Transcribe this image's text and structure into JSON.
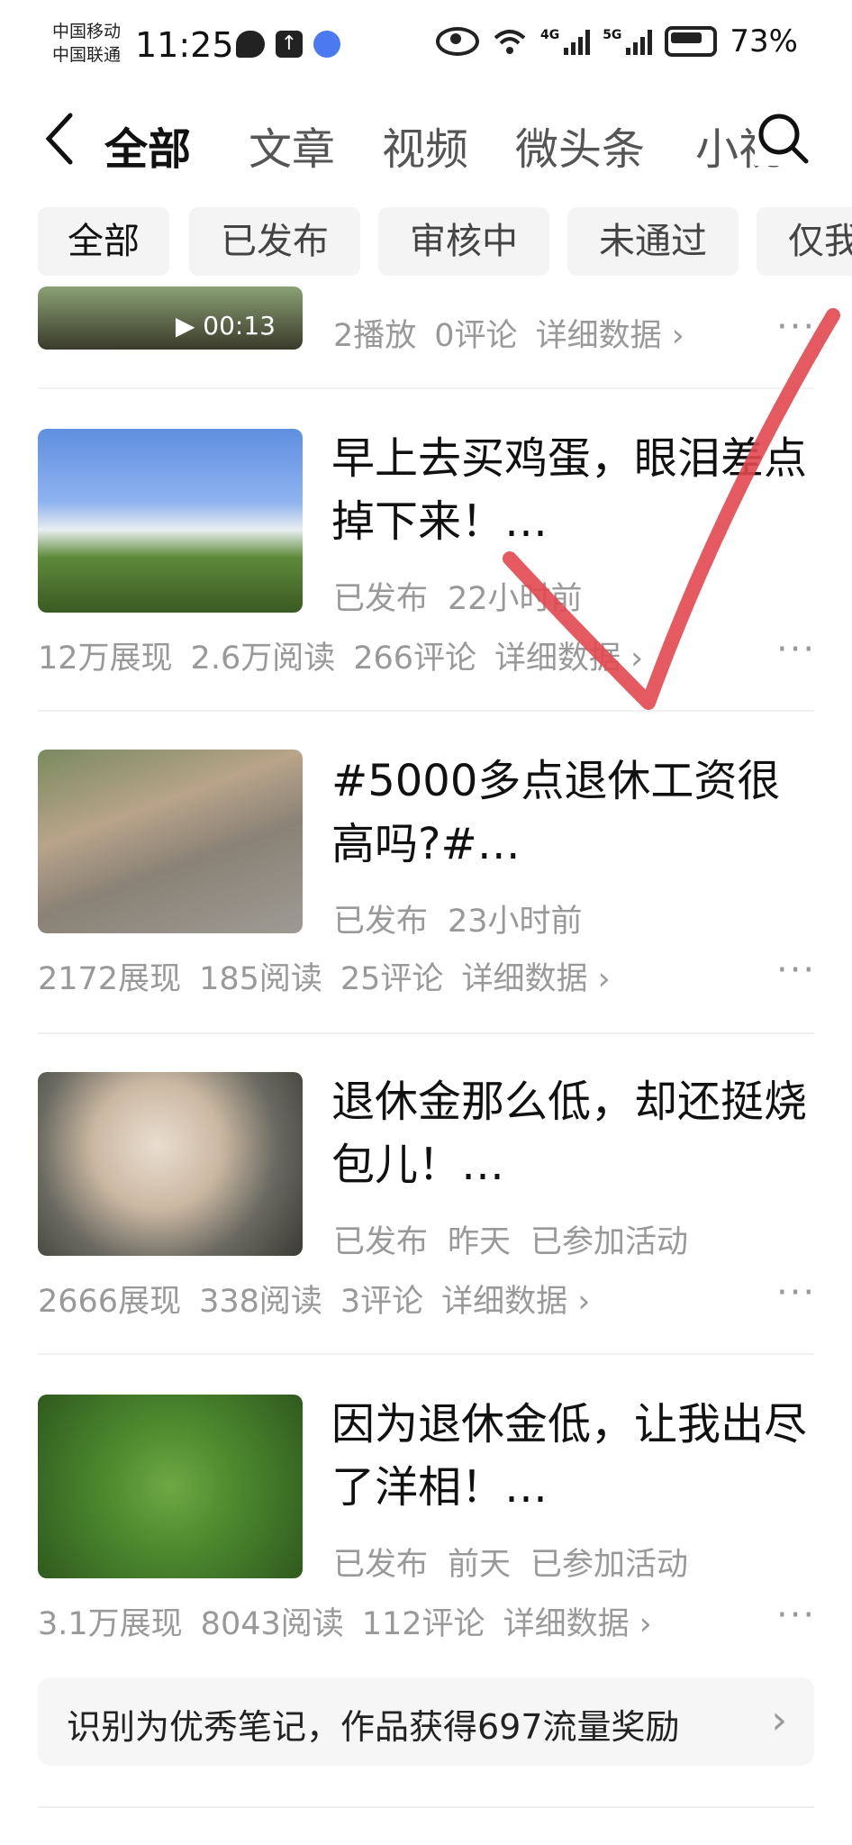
{
  "status_bar": {
    "carrier1": "中国移动",
    "carrier2": "中国联通",
    "time": "11:25",
    "net1": "4G",
    "net2": "5G",
    "battery": "73%"
  },
  "top_tabs": [
    {
      "label": "全部"
    },
    {
      "label": "文章"
    },
    {
      "label": "视频"
    },
    {
      "label": "微头条"
    },
    {
      "label": "小视"
    }
  ],
  "filters": [
    {
      "label": "全部"
    },
    {
      "label": "已发布"
    },
    {
      "label": "审核中"
    },
    {
      "label": "未通过"
    },
    {
      "label": "仅我"
    }
  ],
  "partial_item": {
    "duration": "00:13",
    "stats": [
      "2播放",
      "0评论"
    ],
    "detail": "详细数据"
  },
  "items": [
    {
      "title": "早上去买鸡蛋，眼泪差点掉下来！…",
      "meta": [
        "已发布",
        "22小时前"
      ],
      "stats": [
        "12万展现",
        "2.6万阅读",
        "266评论"
      ],
      "detail": "详细数据"
    },
    {
      "title": "#5000多点退休工资很高吗?#…",
      "meta": [
        "已发布",
        "23小时前"
      ],
      "stats": [
        "2172展现",
        "185阅读",
        "25评论"
      ],
      "detail": "详细数据"
    },
    {
      "title": "退休金那么低，却还挺烧包儿！…",
      "meta": [
        "已发布",
        "昨天",
        "已参加活动"
      ],
      "stats": [
        "2666展现",
        "338阅读",
        "3评论"
      ],
      "detail": "详细数据"
    },
    {
      "title": "因为退休金低，让我出尽了洋相！…",
      "meta": [
        "已发布",
        "前天",
        "已参加活动"
      ],
      "stats": [
        "3.1万展现",
        "8043阅读",
        "112评论"
      ],
      "detail": "详细数据"
    }
  ],
  "banner": {
    "text": "识别为优秀笔记，作品获得697流量奖励"
  },
  "colors": {
    "accent_check": "#e2474f",
    "muted": "#999999"
  }
}
